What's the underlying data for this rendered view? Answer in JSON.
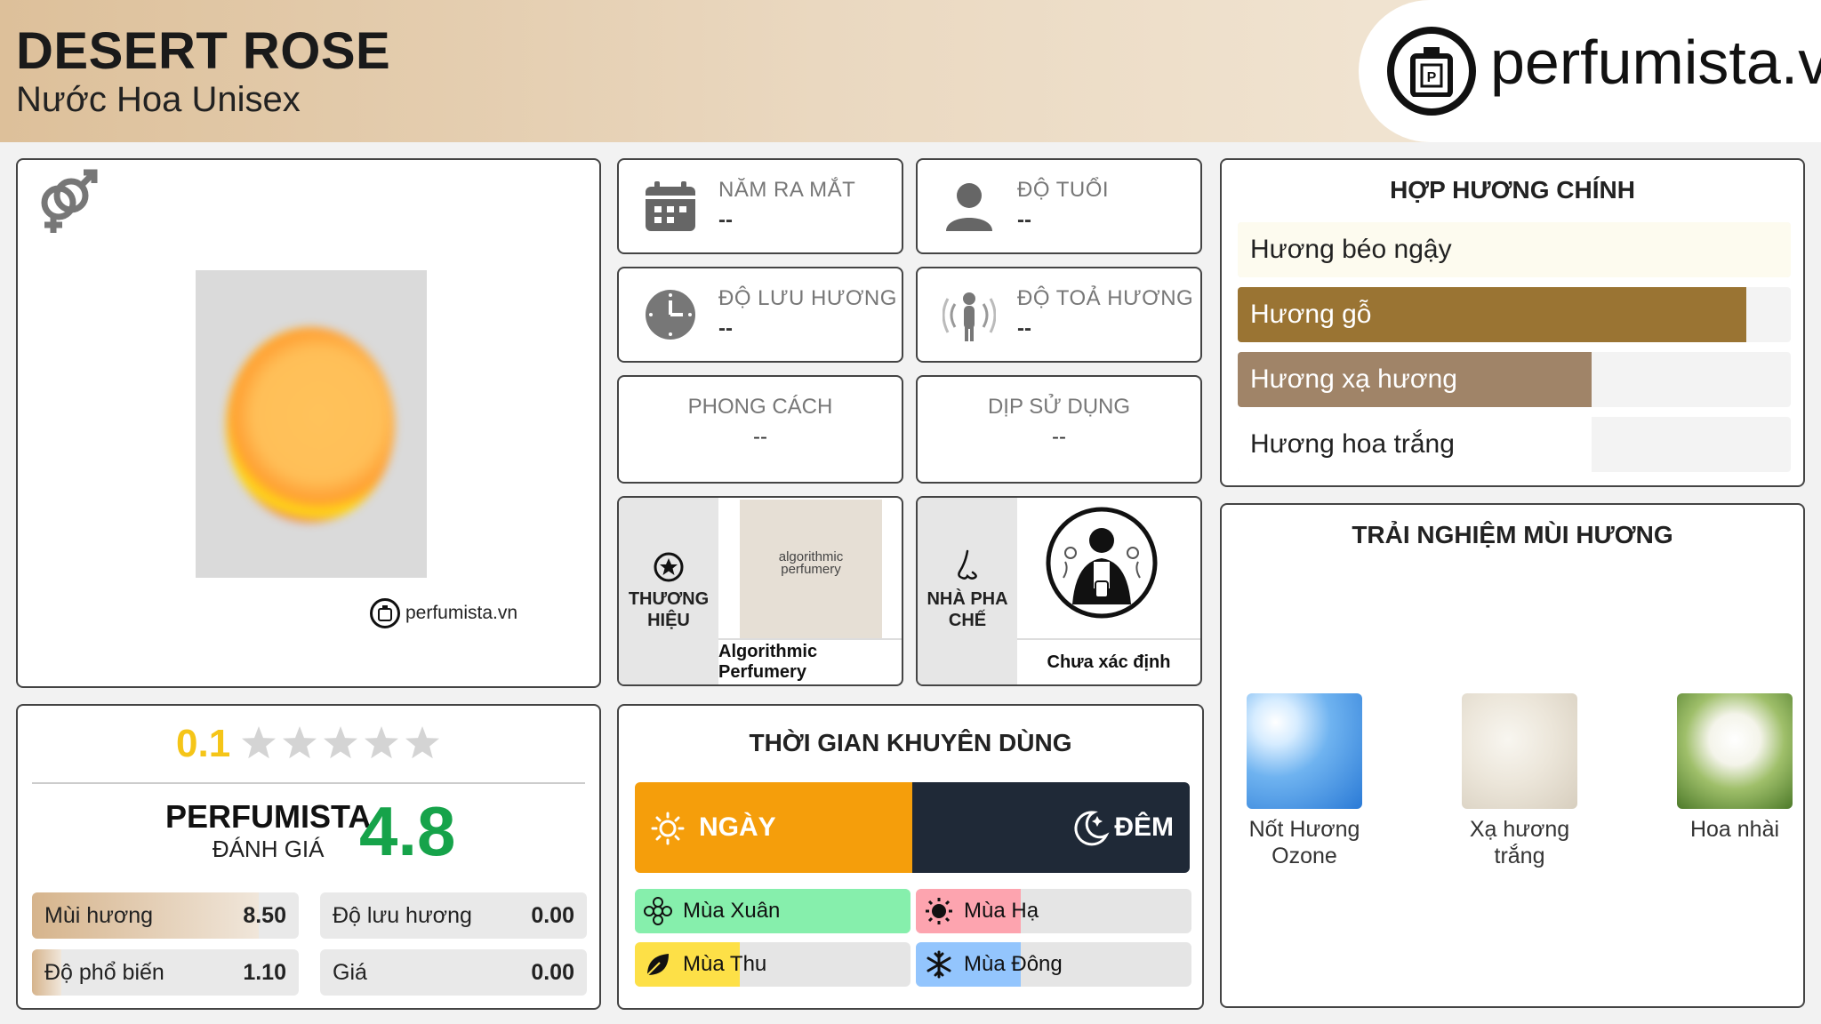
{
  "header": {
    "title": "DESERT ROSE",
    "subtitle": "Nước Hoa Unisex",
    "logo_text": "perfumista.vn"
  },
  "product_card": {
    "watermark": "perfumista.vn"
  },
  "info": {
    "release_year": {
      "label": "NĂM RA MẮT",
      "value": "--"
    },
    "age": {
      "label": "ĐỘ TUỔI",
      "value": "--"
    },
    "longevity": {
      "label": "ĐỘ LƯU HƯƠNG",
      "value": "--"
    },
    "sillage": {
      "label": "ĐỘ TOẢ HƯƠNG",
      "value": "--"
    },
    "style": {
      "label": "PHONG CÁCH",
      "value": "--"
    },
    "occasion": {
      "label": "DỊP SỬ DỤNG",
      "value": "--"
    },
    "brand": {
      "label_1": "THƯƠNG",
      "label_2": "HIỆU",
      "image_text_1": "algorithmic",
      "image_text_2": "perfumery",
      "name": "Algorithmic Perfumery"
    },
    "perfumer": {
      "label_1": "NHÀ PHA",
      "label_2": "CHẾ",
      "name": "Chưa xác định"
    }
  },
  "accords": {
    "title": "HỢP HƯƠNG CHÍNH",
    "items": [
      {
        "label": "Hương béo ngậy",
        "percent": 100,
        "color": "#fdfbef",
        "text_color": "#222222"
      },
      {
        "label": "Hương gỗ",
        "percent": 92,
        "color": "#9a7433",
        "text_color": "#ffffff"
      },
      {
        "label": "Hương xạ hương",
        "percent": 64,
        "color": "#a08468",
        "text_color": "#ffffff"
      },
      {
        "label": "Hương hoa trắng",
        "percent": 64,
        "color": "#ffffff",
        "text_color": "#222222"
      }
    ]
  },
  "notes": {
    "title": "TRẢI NGHIỆM MÙI HƯƠNG",
    "items": [
      {
        "label_1": "Nốt Hương",
        "label_2": "Ozone",
        "image": "sky-image"
      },
      {
        "label_1": "Xạ hương",
        "label_2": "trắng",
        "image": "white-musk-image"
      },
      {
        "label_1": "Hoa nhài",
        "label_2": "",
        "image": "jasmine-image"
      }
    ]
  },
  "rating": {
    "user_score": "0.1",
    "user_stars": 0.1,
    "perfumista_label": "PERFUMISTA",
    "review_label": "ĐÁNH GIÁ",
    "perfumista_score": "4.8",
    "stats": [
      {
        "label": "Mùi hương",
        "value": "8.50",
        "fill": 0.85
      },
      {
        "label": "Độ lưu hương",
        "value": "0.00",
        "fill": 0
      },
      {
        "label": "Độ phổ biến",
        "value": "1.10",
        "fill": 0.11
      },
      {
        "label": "Giá",
        "value": "0.00",
        "fill": 0
      }
    ]
  },
  "time": {
    "title": "THỜI GIAN KHUYÊN DÙNG",
    "day_label": "NGÀY",
    "night_label": "ĐÊM",
    "day_fill": 0.5,
    "seasons": [
      {
        "label": "Mùa Xuân",
        "fill": 1.0,
        "color": "#86efac"
      },
      {
        "label": "Mùa Hạ",
        "fill": 0.38,
        "color": "#fda4af"
      },
      {
        "label": "Mùa Thu",
        "fill": 0.38,
        "color": "#fde047"
      },
      {
        "label": "Mùa Đông",
        "fill": 0.38,
        "color": "#93c5fd"
      }
    ]
  },
  "colors": {
    "score_yellow": "#f5c518",
    "score_green": "#16a34a"
  }
}
